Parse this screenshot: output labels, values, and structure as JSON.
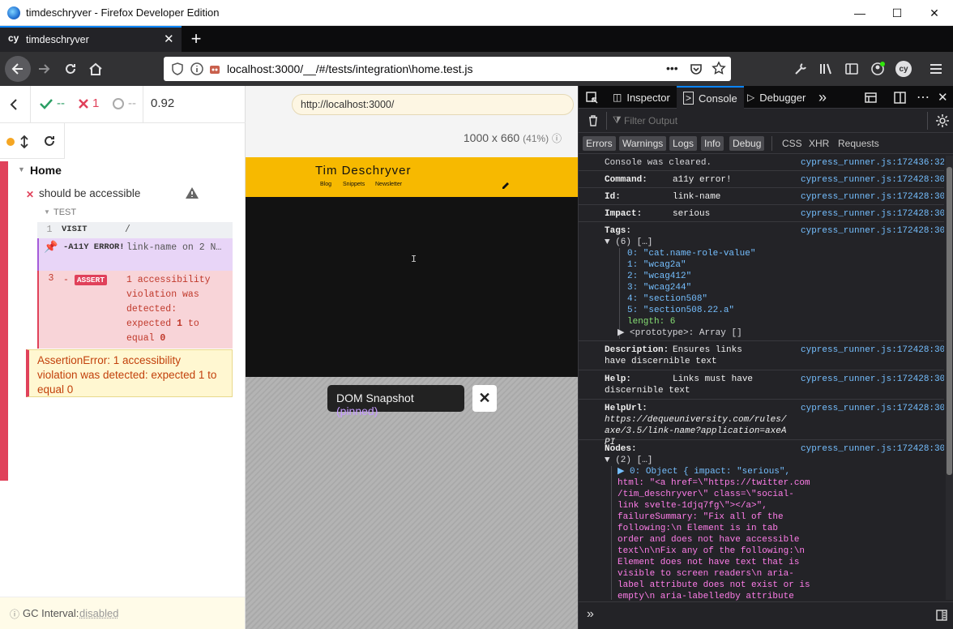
{
  "window": {
    "title": "timdeschryver - Firefox Developer Edition",
    "minimize": "—",
    "maximize": "☐",
    "close": "✕"
  },
  "tab": {
    "brand": "cy",
    "title": "timdeschryver",
    "close": "✕",
    "new": "+"
  },
  "nav": {
    "url_host": "localhost",
    "url_rest": ":3000/__/#/tests/integration\\home.test.js",
    "dots": "•••"
  },
  "cypress": {
    "passed_count": "--",
    "failed_count": "1",
    "pending_count": "--",
    "duration": "0.92",
    "aut_url": "http://localhost:3000/",
    "viewport": "1000 x 660",
    "scale": "(41%)",
    "suite": "Home",
    "test_title": "should be accessible",
    "section": "TEST",
    "commands": [
      {
        "num": "1",
        "name": "VISIT",
        "msg": "/"
      },
      {
        "num": "",
        "name": "-A11Y ERROR!",
        "msg": "link-name on 2 N…"
      },
      {
        "num": "3",
        "name": "-ASSERT",
        "msg": "1 accessibility violation was detected: expected 1 to equal 0"
      }
    ],
    "assert_lines": [
      "1 accessibility",
      "violation was",
      "detected:",
      "expected ",
      "equal "
    ],
    "assert_bold": [
      "1",
      "to",
      "0"
    ],
    "error": "AssertionError: 1 accessibility violation was detected: expected 1 to equal 0",
    "gc_label": "GC Interval:",
    "gc_value": "disabled"
  },
  "site": {
    "title": "Tim Deschryver",
    "links": [
      "Blog",
      "Snippets",
      "Newsletter"
    ],
    "cursor": "I"
  },
  "snapshot": {
    "label": "DOM Snapshot",
    "pinned": "(pinned)",
    "close": "✕"
  },
  "devtools": {
    "tabs": [
      "Inspector",
      "Console",
      "Debugger"
    ],
    "active_tab": "Console",
    "filter_placeholder": "Filter Output",
    "filters": [
      "Errors",
      "Warnings",
      "Logs",
      "Info",
      "Debug"
    ],
    "filters2": [
      "CSS",
      "XHR",
      "Requests"
    ],
    "messages": [
      {
        "text": "Console was cleared.",
        "src": "cypress_runner.js:172436:32"
      },
      {
        "label": "Command:",
        "value": "a11y error!",
        "src": "cypress_runner.js:172428:30"
      },
      {
        "label": "Id:",
        "value": "link-name",
        "src": "cypress_runner.js:172428:30"
      },
      {
        "label": "Impact:",
        "value": "serious",
        "src": "cypress_runner.js:172428:30"
      },
      {
        "label": "Tags:",
        "src": "cypress_runner.js:172428:30"
      },
      {
        "label": "Description:",
        "value": "Ensures links have discernible text",
        "src": "cypress_runner.js:172428:30"
      },
      {
        "label": "Help:",
        "value": "Links must have discernible text",
        "src": "cypress_runner.js:172428:30"
      },
      {
        "label": "HelpUrl:",
        "value": "https://dequeuniversity.com/rules/axe/3.5/link-name?application=axeAPI",
        "src": "cypress_runner.js:172428:30"
      },
      {
        "label": "Nodes:",
        "src": "cypress_runner.js:172428:30"
      }
    ],
    "tags_header": "▼ (6) […]",
    "tags": [
      "0: \"cat.name-role-value\"",
      "1: \"wcag2a\"",
      "2: \"wcag412\"",
      "3: \"wcag244\"",
      "4: \"section508\"",
      "5: \"section508.22.a\""
    ],
    "tags_length": "length: 6",
    "tags_proto": "▶ <prototype>: Array []",
    "nodes_header": "▼ (2) […]",
    "node_lines": [
      "▶ 0: Object { impact: \"serious\",",
      "html: \"<a href=\\\"https://twitter.com",
      "/tim_deschryver\\\" class=\\\"social-",
      "link svelte-1djq7fg\\\"></a>\",",
      "failureSummary: \"Fix all of the",
      "following:\\n  Element is in tab",
      "order and does not have accessible",
      "text\\n\\nFix any of the following:\\n",
      "Element does not have text that is",
      "visible to screen readers\\n  aria-",
      "label attribute does not exist or is",
      "empty\\n  aria-labelledby attribute"
    ],
    "input_prompt": "»"
  }
}
